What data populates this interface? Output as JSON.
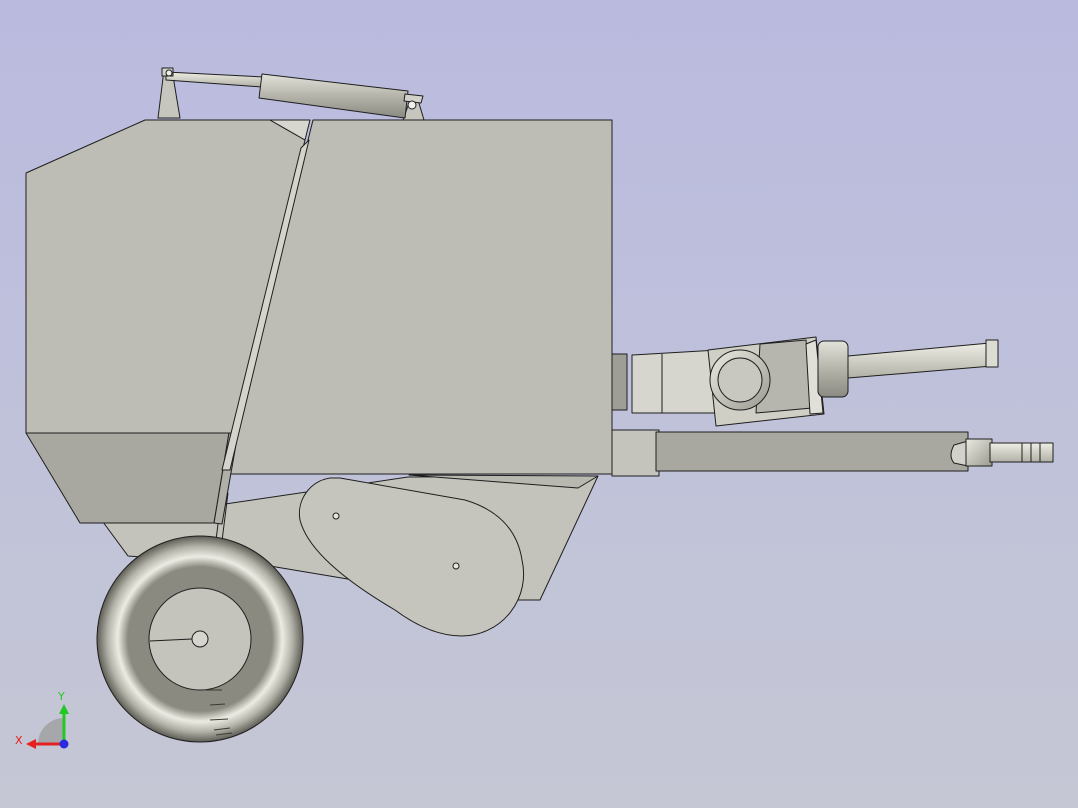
{
  "triad": {
    "x_label": "X",
    "y_label": "Y"
  },
  "colors": {
    "x_axis": "#e52020",
    "y_axis": "#22c922",
    "z_axis": "#2a2ae0"
  }
}
